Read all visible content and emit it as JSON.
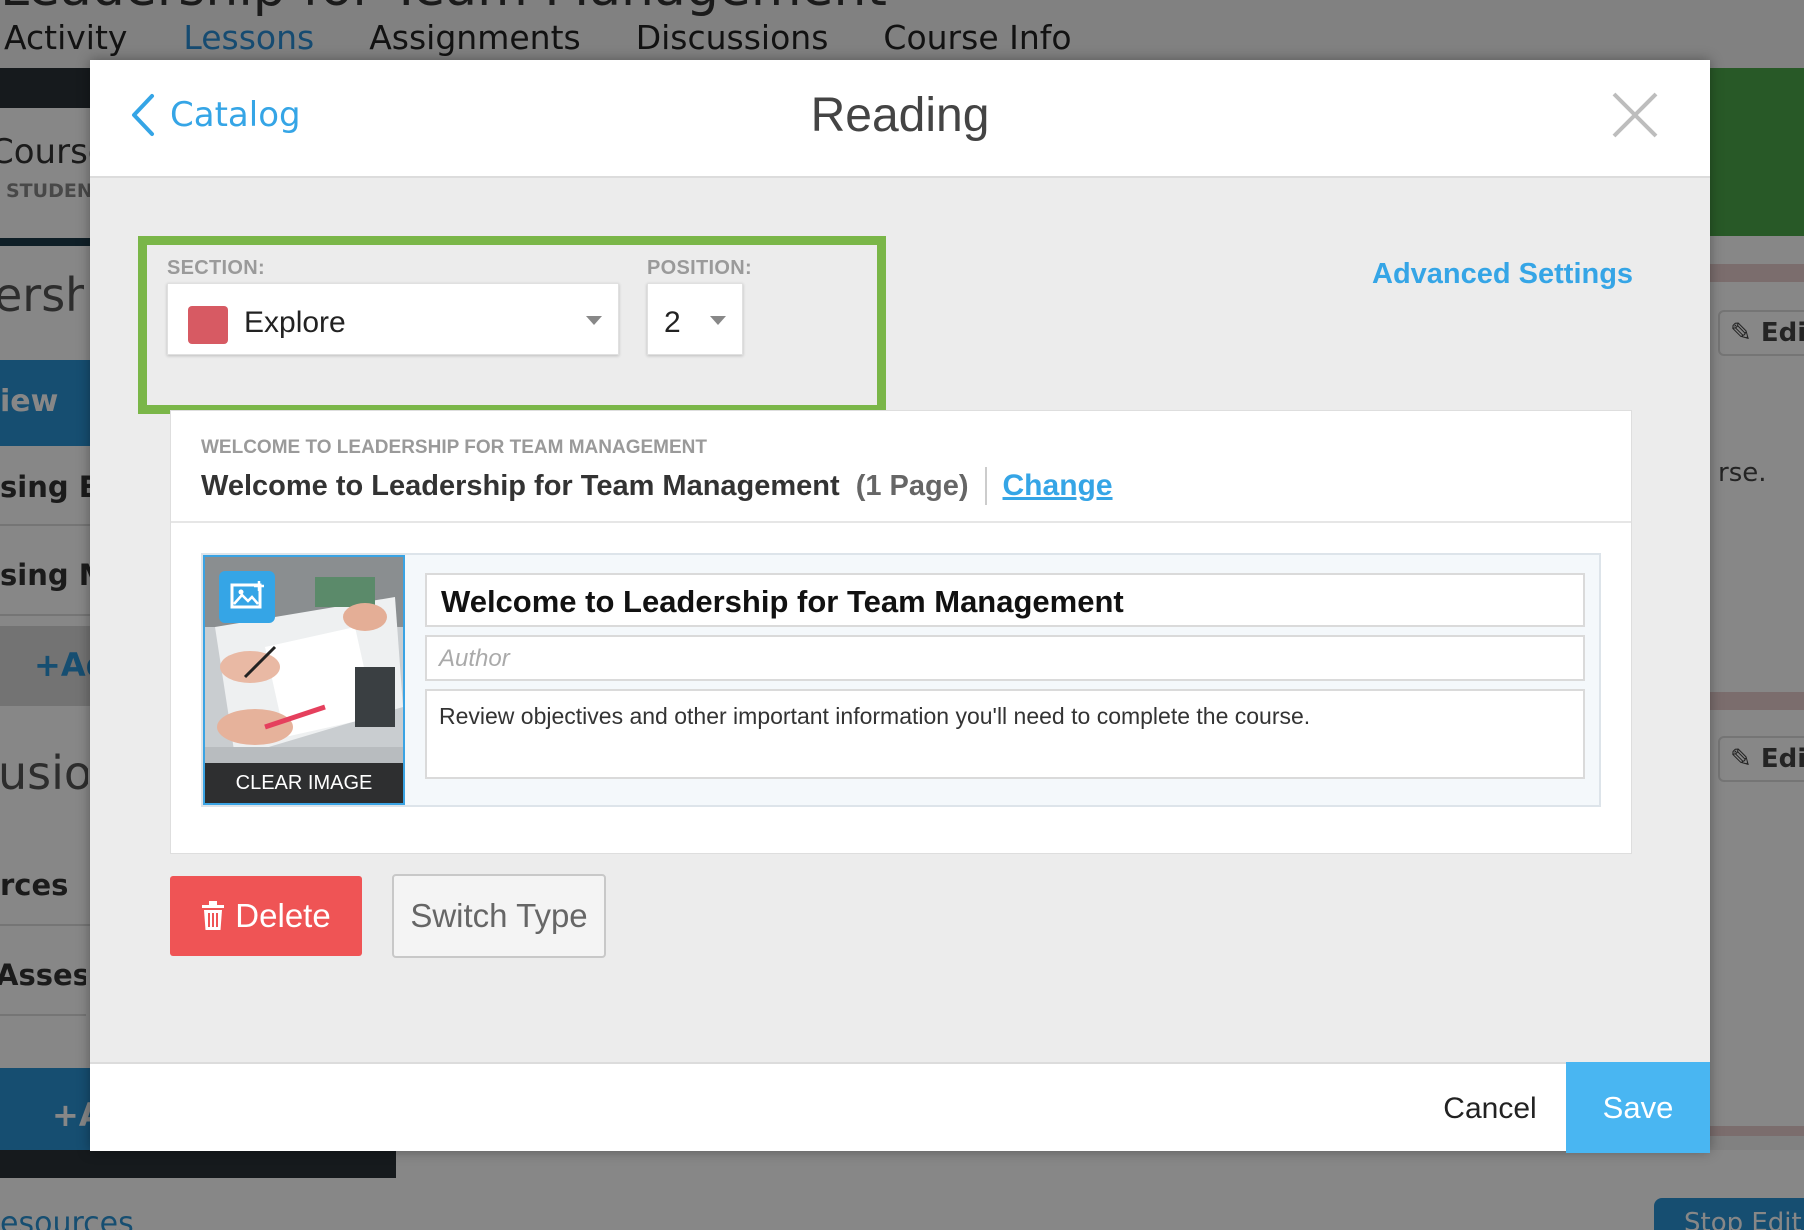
{
  "background": {
    "course_title": "Leadership for Team Management",
    "nav": [
      "Activity",
      "Lessons",
      "Assignments",
      "Discussions",
      "Course Info"
    ],
    "nav_active": "Lessons",
    "left_course": "Course",
    "left_student": "STUDENT",
    "left_items": [
      "ership",
      "iew",
      "sing Ef",
      "sing M",
      "+Ad",
      "usion",
      "rces",
      "Assessm"
    ],
    "left_bottom_add": "+A",
    "right_edit": "Edit",
    "right_text": "rse.",
    "bottom_resources": "esources",
    "bottom_stop_edit": "Stop Edit"
  },
  "modal": {
    "back_label": "Catalog",
    "title": "Reading",
    "close_icon": "close-icon",
    "section_label": "SECTION:",
    "section_value": "Explore",
    "section_color": "#d75a63",
    "position_label": "POSITION:",
    "position_value": "2",
    "advanced_settings": "Advanced Settings",
    "highlight_color": "#7ab648",
    "card": {
      "eyebrow": "WELCOME TO LEADERSHIP FOR TEAM MANAGEMENT",
      "title": "Welcome to Leadership for Team Management",
      "pages": "(1 Page)",
      "change": "Change"
    },
    "item": {
      "clear_image": "CLEAR IMAGE",
      "title_value": "Welcome to Leadership for Team Management",
      "author_placeholder": "Author",
      "description": "Review objectives and other important information you'll need to complete the course."
    },
    "delete_label": "Delete",
    "switch_type_label": "Switch Type",
    "cancel_label": "Cancel",
    "save_label": "Save",
    "accent_color": "#35a5e6"
  }
}
